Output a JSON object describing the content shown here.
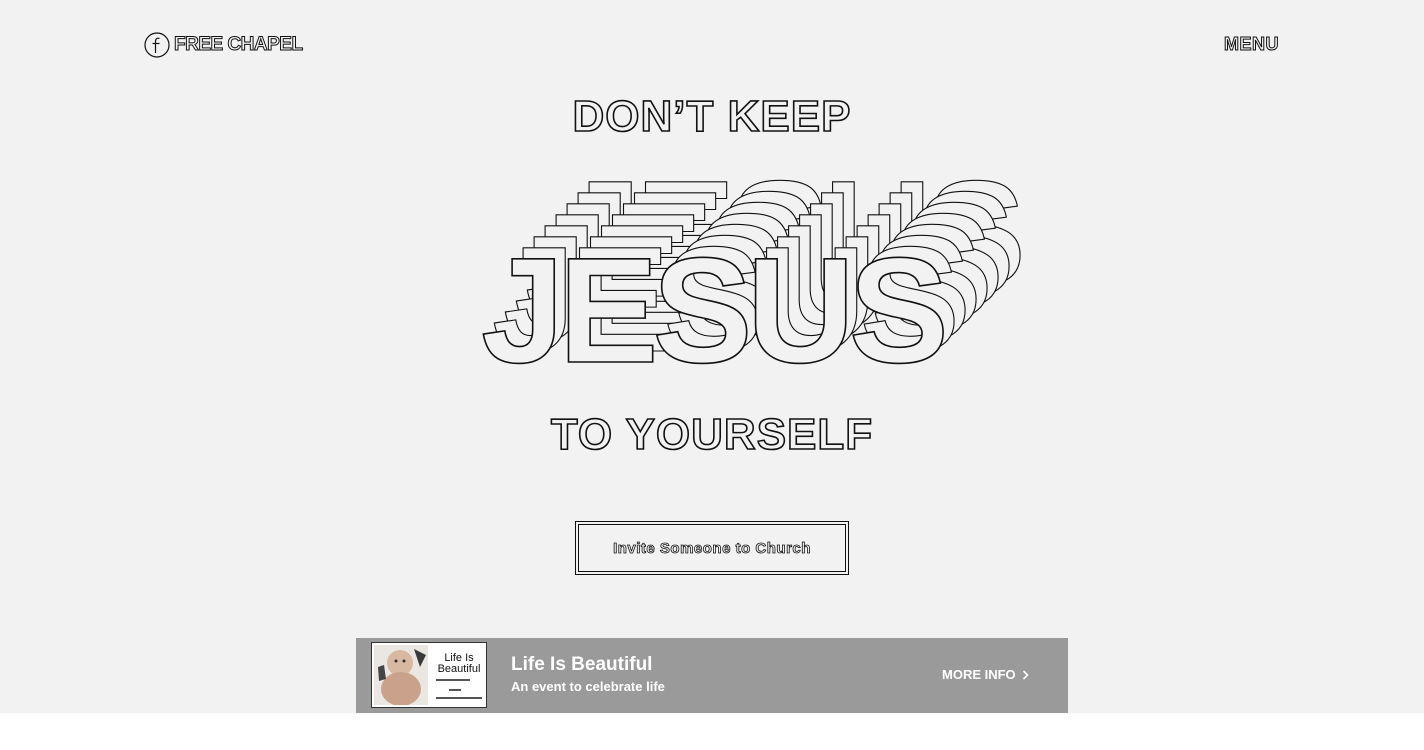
{
  "header": {
    "logo_text": "FREE CHAPEL",
    "menu_label": "MENU"
  },
  "hero": {
    "line_top": "DON’T KEEP",
    "headline": "JESUS",
    "line_bottom": "TO YOURSELF",
    "cta_label": "Invite Someone to Church"
  },
  "event": {
    "title": "Life Is Beautiful",
    "subtitle": "An event to celebrate life",
    "more_info": "MORE INFO",
    "thumbnail_text": "Life Is Beautiful",
    "banner_color": "#9a9a9a"
  },
  "icons": {
    "logo": "free-chapel-logo-icon",
    "chevron": "chevron-right-icon"
  }
}
